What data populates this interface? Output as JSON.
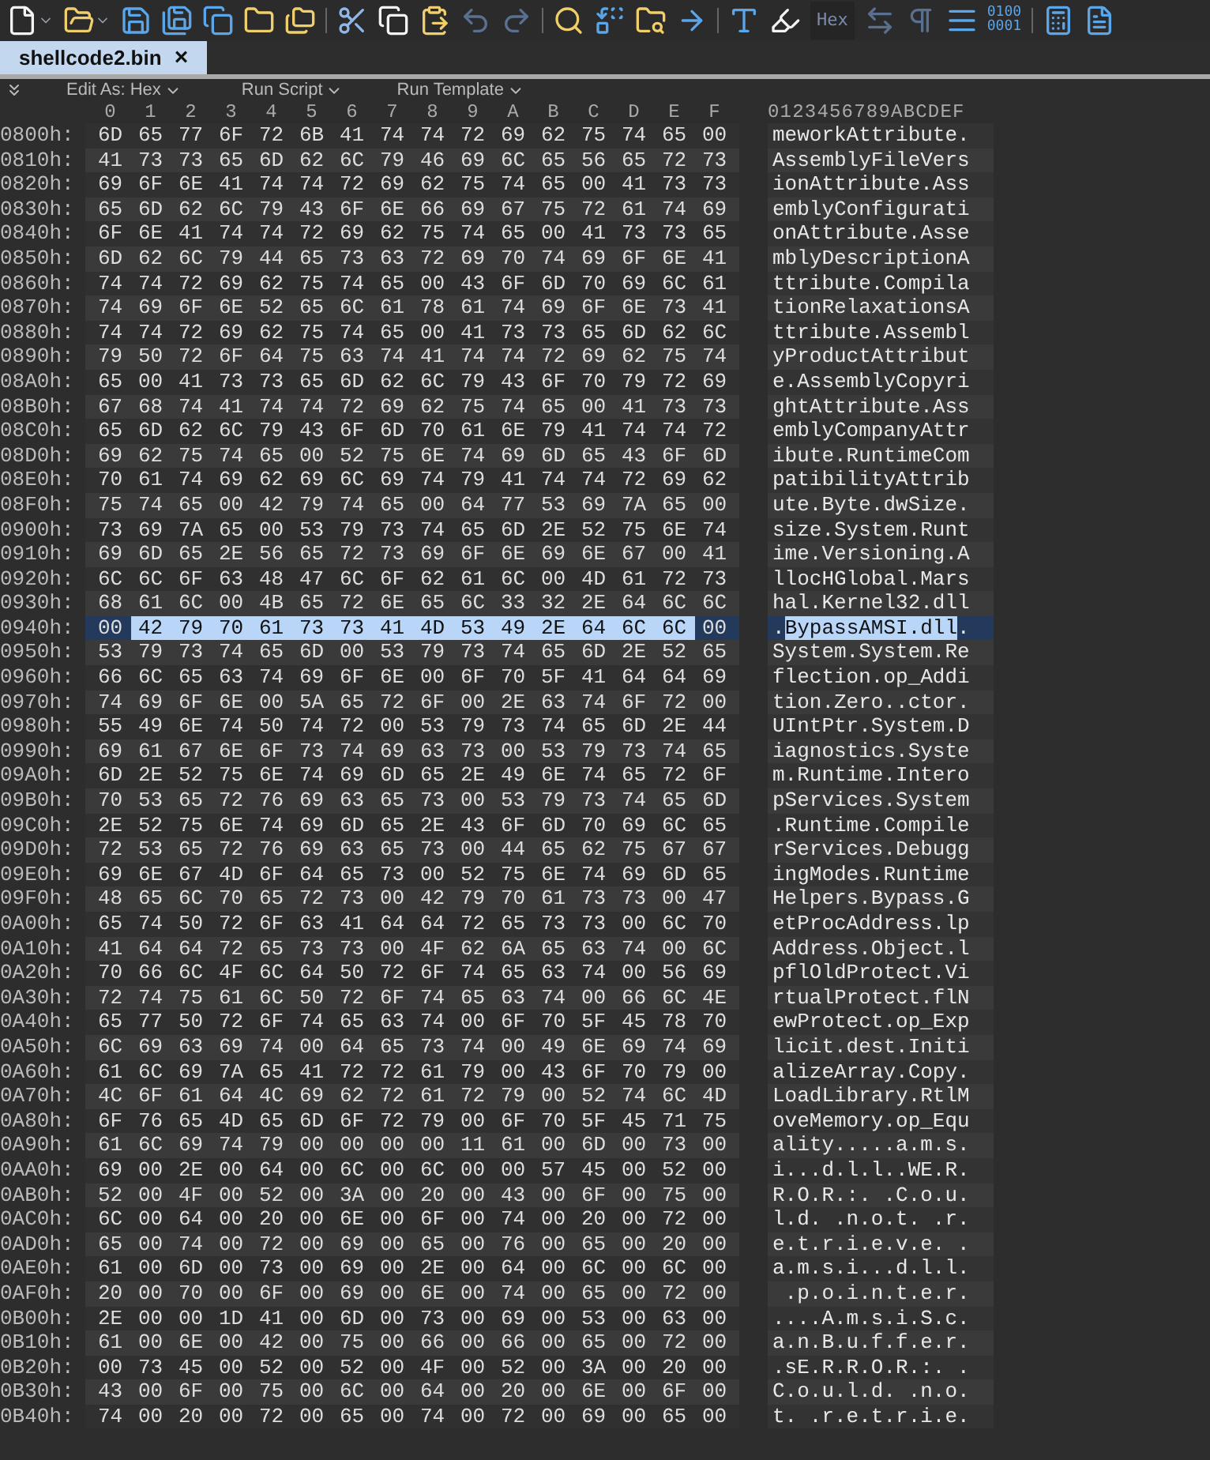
{
  "toolbar": {
    "hex_label": "Hex",
    "binary_label": [
      "0100",
      "0001"
    ]
  },
  "tabs": [
    {
      "label": "shellcode2.bin",
      "close": "×",
      "selected": true
    }
  ],
  "subtoolbar": [
    "Edit As: Hex",
    "Run Script",
    "Run Template"
  ],
  "columns": [
    "0",
    "1",
    "2",
    "3",
    "4",
    "5",
    "6",
    "7",
    "8",
    "9",
    "A",
    "B",
    "C",
    "D",
    "E",
    "F"
  ],
  "ascii_header": "0123456789ABCDEF",
  "rows": [
    {
      "address": "0800h:",
      "hex": "6D 65 77 6F 72 6B 41 74 74 72 69 62 75 74 65 00",
      "ascii": "meworkAttribute.",
      "selected": false
    },
    {
      "address": "0810h:",
      "hex": "41 73 73 65 6D 62 6C 79 46 69 6C 65 56 65 72 73",
      "ascii": "AssemblyFileVers",
      "selected": false
    },
    {
      "address": "0820h:",
      "hex": "69 6F 6E 41 74 74 72 69 62 75 74 65 00 41 73 73",
      "ascii": "ionAttribute.Ass",
      "selected": false
    },
    {
      "address": "0830h:",
      "hex": "65 6D 62 6C 79 43 6F 6E 66 69 67 75 72 61 74 69",
      "ascii": "emblyConfigurati",
      "selected": false
    },
    {
      "address": "0840h:",
      "hex": "6F 6E 41 74 74 72 69 62 75 74 65 00 41 73 73 65",
      "ascii": "onAttribute.Asse",
      "selected": false
    },
    {
      "address": "0850h:",
      "hex": "6D 62 6C 79 44 65 73 63 72 69 70 74 69 6F 6E 41",
      "ascii": "mblyDescriptionA",
      "selected": false
    },
    {
      "address": "0860h:",
      "hex": "74 74 72 69 62 75 74 65 00 43 6F 6D 70 69 6C 61",
      "ascii": "ttribute.Compila",
      "selected": false
    },
    {
      "address": "0870h:",
      "hex": "74 69 6F 6E 52 65 6C 61 78 61 74 69 6F 6E 73 41",
      "ascii": "tionRelaxationsA",
      "selected": false
    },
    {
      "address": "0880h:",
      "hex": "74 74 72 69 62 75 74 65 00 41 73 73 65 6D 62 6C",
      "ascii": "ttribute.Assembl",
      "selected": false
    },
    {
      "address": "0890h:",
      "hex": "79 50 72 6F 64 75 63 74 41 74 74 72 69 62 75 74",
      "ascii": "yProductAttribut",
      "selected": false
    },
    {
      "address": "08A0h:",
      "hex": "65 00 41 73 73 65 6D 62 6C 79 43 6F 70 79 72 69",
      "ascii": "e.AssemblyCopyri",
      "selected": false
    },
    {
      "address": "08B0h:",
      "hex": "67 68 74 41 74 74 72 69 62 75 74 65 00 41 73 73",
      "ascii": "ghtAttribute.Ass",
      "selected": false
    },
    {
      "address": "08C0h:",
      "hex": "65 6D 62 6C 79 43 6F 6D 70 61 6E 79 41 74 74 72",
      "ascii": "emblyCompanyAttr",
      "selected": false
    },
    {
      "address": "08D0h:",
      "hex": "69 62 75 74 65 00 52 75 6E 74 69 6D 65 43 6F 6D",
      "ascii": "ibute.RuntimeCom",
      "selected": false
    },
    {
      "address": "08E0h:",
      "hex": "70 61 74 69 62 69 6C 69 74 79 41 74 74 72 69 62",
      "ascii": "patibilityAttrib",
      "selected": false
    },
    {
      "address": "08F0h:",
      "hex": "75 74 65 00 42 79 74 65 00 64 77 53 69 7A 65 00",
      "ascii": "ute.Byte.dwSize.",
      "selected": false
    },
    {
      "address": "0900h:",
      "hex": "73 69 7A 65 00 53 79 73 74 65 6D 2E 52 75 6E 74",
      "ascii": "size.System.Runt",
      "selected": false
    },
    {
      "address": "0910h:",
      "hex": "69 6D 65 2E 56 65 72 73 69 6F 6E 69 6E 67 00 41",
      "ascii": "ime.Versioning.A",
      "selected": false
    },
    {
      "address": "0920h:",
      "hex": "6C 6C 6F 63 48 47 6C 6F 62 61 6C 00 4D 61 72 73",
      "ascii": "llocHGlobal.Mars",
      "selected": false
    },
    {
      "address": "0930h:",
      "hex": "68 61 6C 00 4B 65 72 6E 65 6C 33 32 2E 64 6C 6C",
      "ascii": "hal.Kernel32.dll",
      "selected": false
    },
    {
      "address": "0940h:",
      "selected": true,
      "hex_parts": [
        {
          "text": "00",
          "selected": false
        },
        {
          "text": "42 79 70 61 73 73 41 4D 53 49 2E 64 6C 6C",
          "selected": true
        },
        {
          "text": "00",
          "selected": false
        }
      ],
      "ascii_parts": [
        {
          "text": ".",
          "selected": false
        },
        {
          "text": "BypassAMSI.dll",
          "selected": true
        },
        {
          "text": ".",
          "selected": false
        }
      ]
    },
    {
      "address": "0950h:",
      "hex": "53 79 73 74 65 6D 00 53 79 73 74 65 6D 2E 52 65",
      "ascii": "System.System.Re",
      "selected": false
    },
    {
      "address": "0960h:",
      "hex": "66 6C 65 63 74 69 6F 6E 00 6F 70 5F 41 64 64 69",
      "ascii": "flection.op_Addi",
      "selected": false
    },
    {
      "address": "0970h:",
      "hex": "74 69 6F 6E 00 5A 65 72 6F 00 2E 63 74 6F 72 00",
      "ascii": "tion.Zero..ctor.",
      "selected": false
    },
    {
      "address": "0980h:",
      "hex": "55 49 6E 74 50 74 72 00 53 79 73 74 65 6D 2E 44",
      "ascii": "UIntPtr.System.D",
      "selected": false
    },
    {
      "address": "0990h:",
      "hex": "69 61 67 6E 6F 73 74 69 63 73 00 53 79 73 74 65",
      "ascii": "iagnostics.Syste",
      "selected": false
    },
    {
      "address": "09A0h:",
      "hex": "6D 2E 52 75 6E 74 69 6D 65 2E 49 6E 74 65 72 6F",
      "ascii": "m.Runtime.Intero",
      "selected": false
    },
    {
      "address": "09B0h:",
      "hex": "70 53 65 72 76 69 63 65 73 00 53 79 73 74 65 6D",
      "ascii": "pServices.System",
      "selected": false
    },
    {
      "address": "09C0h:",
      "hex": "2E 52 75 6E 74 69 6D 65 2E 43 6F 6D 70 69 6C 65",
      "ascii": ".Runtime.Compile",
      "selected": false
    },
    {
      "address": "09D0h:",
      "hex": "72 53 65 72 76 69 63 65 73 00 44 65 62 75 67 67",
      "ascii": "rServices.Debugg",
      "selected": false
    },
    {
      "address": "09E0h:",
      "hex": "69 6E 67 4D 6F 64 65 73 00 52 75 6E 74 69 6D 65",
      "ascii": "ingModes.Runtime",
      "selected": false
    },
    {
      "address": "09F0h:",
      "hex": "48 65 6C 70 65 72 73 00 42 79 70 61 73 73 00 47",
      "ascii": "Helpers.Bypass.G",
      "selected": false
    },
    {
      "address": "0A00h:",
      "hex": "65 74 50 72 6F 63 41 64 64 72 65 73 73 00 6C 70",
      "ascii": "etProcAddress.lp",
      "selected": false
    },
    {
      "address": "0A10h:",
      "hex": "41 64 64 72 65 73 73 00 4F 62 6A 65 63 74 00 6C",
      "ascii": "Address.Object.l",
      "selected": false
    },
    {
      "address": "0A20h:",
      "hex": "70 66 6C 4F 6C 64 50 72 6F 74 65 63 74 00 56 69",
      "ascii": "pflOldProtect.Vi",
      "selected": false
    },
    {
      "address": "0A30h:",
      "hex": "72 74 75 61 6C 50 72 6F 74 65 63 74 00 66 6C 4E",
      "ascii": "rtualProtect.flN",
      "selected": false
    },
    {
      "address": "0A40h:",
      "hex": "65 77 50 72 6F 74 65 63 74 00 6F 70 5F 45 78 70",
      "ascii": "ewProtect.op_Exp",
      "selected": false
    },
    {
      "address": "0A50h:",
      "hex": "6C 69 63 69 74 00 64 65 73 74 00 49 6E 69 74 69",
      "ascii": "licit.dest.Initi",
      "selected": false
    },
    {
      "address": "0A60h:",
      "hex": "61 6C 69 7A 65 41 72 72 61 79 00 43 6F 70 79 00",
      "ascii": "alizeArray.Copy.",
      "selected": false
    },
    {
      "address": "0A70h:",
      "hex": "4C 6F 61 64 4C 69 62 72 61 72 79 00 52 74 6C 4D",
      "ascii": "LoadLibrary.RtlM",
      "selected": false
    },
    {
      "address": "0A80h:",
      "hex": "6F 76 65 4D 65 6D 6F 72 79 00 6F 70 5F 45 71 75",
      "ascii": "oveMemory.op_Equ",
      "selected": false
    },
    {
      "address": "0A90h:",
      "hex": "61 6C 69 74 79 00 00 00 00 11 61 00 6D 00 73 00",
      "ascii": "ality.....a.m.s.",
      "selected": false
    },
    {
      "address": "0AA0h:",
      "hex": "69 00 2E 00 64 00 6C 00 6C 00 00 57 45 00 52 00",
      "ascii": "i...d.l.l..WE.R.",
      "selected": false
    },
    {
      "address": "0AB0h:",
      "hex": "52 00 4F 00 52 00 3A 00 20 00 43 00 6F 00 75 00",
      "ascii": "R.O.R.:. .C.o.u.",
      "selected": false
    },
    {
      "address": "0AC0h:",
      "hex": "6C 00 64 00 20 00 6E 00 6F 00 74 00 20 00 72 00",
      "ascii": "l.d. .n.o.t. .r.",
      "selected": false
    },
    {
      "address": "0AD0h:",
      "hex": "65 00 74 00 72 00 69 00 65 00 76 00 65 00 20 00",
      "ascii": "e.t.r.i.e.v.e. .",
      "selected": false
    },
    {
      "address": "0AE0h:",
      "hex": "61 00 6D 00 73 00 69 00 2E 00 64 00 6C 00 6C 00",
      "ascii": "a.m.s.i...d.l.l.",
      "selected": false
    },
    {
      "address": "0AF0h:",
      "hex": "20 00 70 00 6F 00 69 00 6E 00 74 00 65 00 72 00",
      "ascii": " .p.o.i.n.t.e.r.",
      "selected": false
    },
    {
      "address": "0B00h:",
      "hex": "2E 00 00 1D 41 00 6D 00 73 00 69 00 53 00 63 00",
      "ascii": "....A.m.s.i.S.c.",
      "selected": false
    },
    {
      "address": "0B10h:",
      "hex": "61 00 6E 00 42 00 75 00 66 00 66 00 65 00 72 00",
      "ascii": "a.n.B.u.f.f.e.r.",
      "selected": false
    },
    {
      "address": "0B20h:",
      "hex": "00 73 45 00 52 00 52 00 4F 00 52 00 3A 00 20 00",
      "ascii": ".sE.R.R.O.R.:. .",
      "selected": false
    },
    {
      "address": "0B30h:",
      "hex": "43 00 6F 00 75 00 6C 00 64 00 20 00 6E 00 6F 00",
      "ascii": "C.o.u.l.d. .n.o.",
      "selected": false
    },
    {
      "address": "0B40h:",
      "hex": "74 00 20 00 72 00 65 00 74 00 72 00 69 00 65 00",
      "ascii": "t. .r.e.t.r.i.e.",
      "selected": false
    }
  ]
}
